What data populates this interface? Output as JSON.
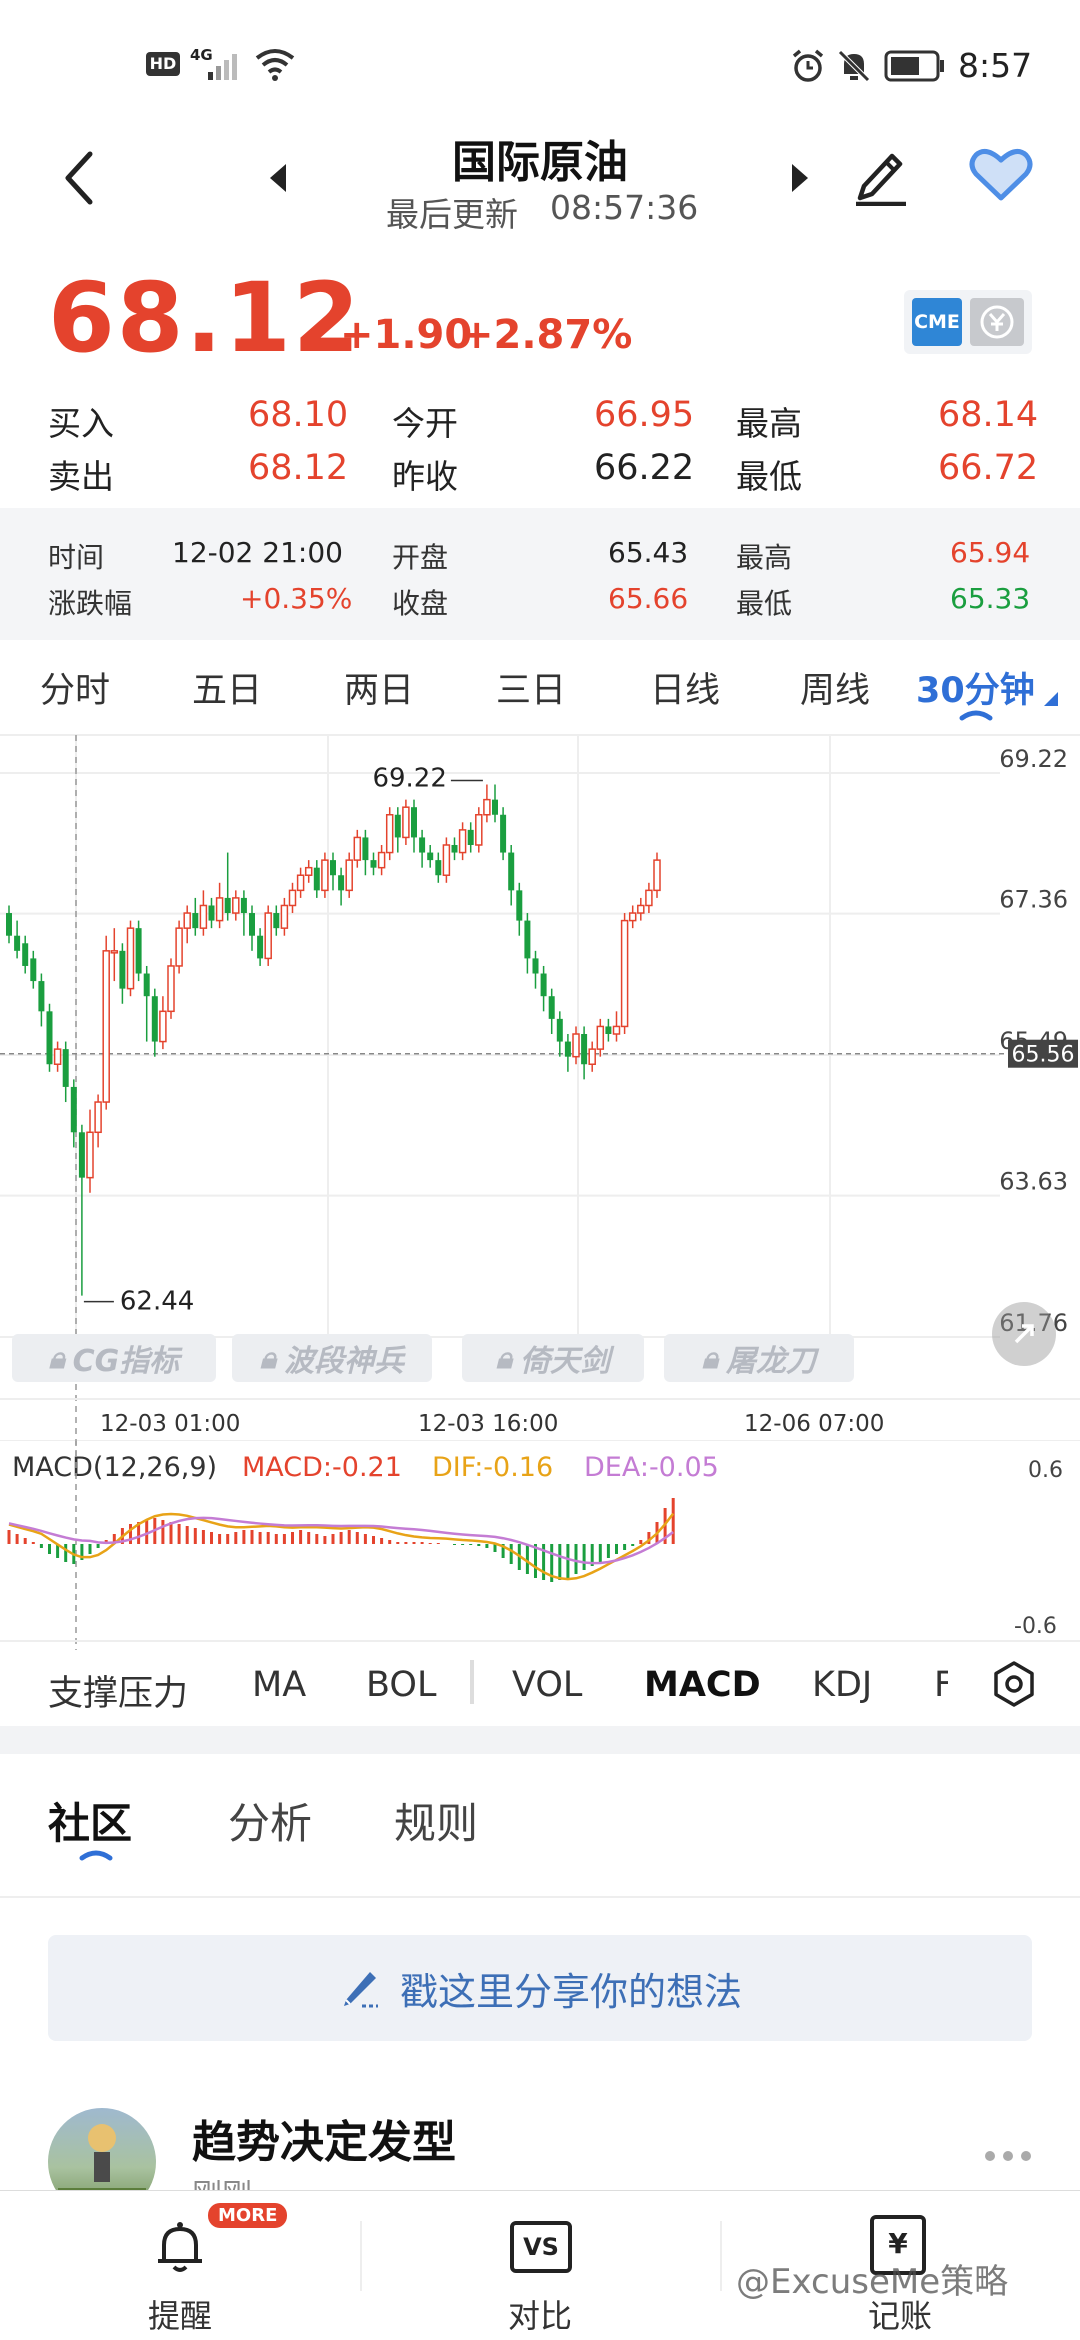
{
  "status_bar": {
    "hd_label": "HD",
    "network_label": "4G",
    "time": "8:57"
  },
  "header": {
    "title": "国际原油",
    "last_update_label": "最后更新",
    "last_update_time": "08:57:36"
  },
  "quote": {
    "price": "68.12",
    "change": "+1.90",
    "change_pct": "+2.87%",
    "exchange_badge": "CME",
    "buy_label": "买入",
    "buy": "68.10",
    "sell_label": "卖出",
    "sell": "68.12",
    "open_label": "今开",
    "open": "66.95",
    "prev_close_label": "昨收",
    "prev_close": "66.22",
    "high_label": "最高",
    "high": "68.14",
    "low_label": "最低",
    "low": "66.72"
  },
  "candle_detail": {
    "time_label": "时间",
    "time": "12-02 21:00",
    "chg_label": "涨跌幅",
    "chg": "+0.35%",
    "open_label": "开盘",
    "open": "65.43",
    "close_label": "收盘",
    "close": "65.66",
    "high_label": "最高",
    "high": "65.94",
    "low_label": "最低",
    "low": "65.33"
  },
  "period_tabs": [
    {
      "label": "分时"
    },
    {
      "label": "五日"
    },
    {
      "label": "两日"
    },
    {
      "label": "三日"
    },
    {
      "label": "日线"
    },
    {
      "label": "周线"
    },
    {
      "label": "30分钟",
      "active": true
    }
  ],
  "chart_data": {
    "type": "candlestick",
    "y_ticks": [
      "69.22",
      "67.36",
      "65.49",
      "63.63",
      "61.76"
    ],
    "ylim": [
      61.76,
      69.22
    ],
    "x_labels": [
      "12-03 01:00",
      "12-03 16:00",
      "12-06 07:00"
    ],
    "max_label": "69.22",
    "min_label": "62.44",
    "current_price_label": "65.56",
    "candles": [
      [
        67.5,
        67.2,
        67.6,
        67.1
      ],
      [
        67.2,
        67.0,
        67.4,
        66.9
      ],
      [
        67.1,
        66.8,
        67.2,
        66.7
      ],
      [
        66.9,
        66.6,
        67.0,
        66.5
      ],
      [
        66.6,
        66.2,
        66.7,
        66.0
      ],
      [
        66.2,
        65.5,
        66.3,
        65.4
      ],
      [
        65.5,
        65.7,
        65.8,
        65.4
      ],
      [
        65.7,
        65.2,
        65.8,
        65.0
      ],
      [
        65.2,
        64.6,
        65.3,
        64.4
      ],
      [
        64.6,
        64.0,
        64.7,
        62.44
      ],
      [
        64.0,
        64.6,
        64.9,
        63.8
      ],
      [
        64.6,
        65.0,
        65.1,
        64.4
      ],
      [
        65.0,
        67.0,
        67.2,
        64.9
      ],
      [
        67.0,
        67.0,
        67.3,
        66.6
      ],
      [
        67.0,
        66.5,
        67.1,
        66.3
      ],
      [
        66.5,
        67.3,
        67.4,
        66.4
      ],
      [
        67.3,
        66.7,
        67.4,
        66.6
      ],
      [
        66.7,
        66.4,
        66.8,
        65.8
      ],
      [
        66.4,
        65.8,
        66.5,
        65.6
      ],
      [
        65.8,
        66.2,
        66.4,
        65.7
      ],
      [
        66.2,
        66.8,
        66.9,
        66.1
      ],
      [
        66.8,
        67.3,
        67.4,
        66.7
      ],
      [
        67.3,
        67.5,
        67.6,
        67.1
      ],
      [
        67.5,
        67.3,
        67.7,
        67.2
      ],
      [
        67.3,
        67.6,
        67.8,
        67.2
      ],
      [
        67.6,
        67.4,
        67.7,
        67.3
      ],
      [
        67.4,
        67.7,
        67.9,
        67.3
      ],
      [
        67.7,
        67.5,
        68.3,
        67.4
      ],
      [
        67.5,
        67.7,
        67.8,
        67.4
      ],
      [
        67.7,
        67.5,
        67.8,
        67.2
      ],
      [
        67.5,
        67.2,
        67.6,
        67.0
      ],
      [
        67.2,
        66.9,
        67.3,
        66.8
      ],
      [
        66.9,
        67.5,
        67.6,
        66.8
      ],
      [
        67.5,
        67.3,
        67.6,
        67.2
      ],
      [
        67.3,
        67.6,
        67.7,
        67.2
      ],
      [
        67.6,
        67.8,
        67.9,
        67.5
      ],
      [
        67.8,
        68.0,
        68.1,
        67.7
      ],
      [
        68.0,
        68.1,
        68.2,
        67.9
      ],
      [
        68.1,
        67.8,
        68.2,
        67.7
      ],
      [
        67.8,
        68.2,
        68.3,
        67.7
      ],
      [
        68.2,
        68.0,
        68.3,
        67.8
      ],
      [
        68.0,
        67.8,
        68.1,
        67.6
      ],
      [
        67.8,
        68.2,
        68.3,
        67.7
      ],
      [
        68.2,
        68.5,
        68.6,
        68.1
      ],
      [
        68.5,
        68.2,
        68.6,
        68.0
      ],
      [
        68.2,
        68.1,
        68.3,
        68.0
      ],
      [
        68.1,
        68.3,
        68.4,
        68.0
      ],
      [
        68.3,
        68.8,
        68.9,
        68.2
      ],
      [
        68.8,
        68.5,
        68.9,
        68.3
      ],
      [
        68.5,
        68.9,
        69.0,
        68.4
      ],
      [
        68.9,
        68.5,
        69.0,
        68.3
      ],
      [
        68.5,
        68.3,
        68.6,
        68.1
      ],
      [
        68.3,
        68.2,
        68.4,
        68.1
      ],
      [
        68.2,
        68.0,
        68.3,
        67.9
      ],
      [
        68.0,
        68.4,
        68.5,
        67.9
      ],
      [
        68.4,
        68.3,
        68.5,
        68.2
      ],
      [
        68.3,
        68.6,
        68.7,
        68.2
      ],
      [
        68.6,
        68.4,
        68.7,
        68.3
      ],
      [
        68.4,
        68.8,
        68.9,
        68.3
      ],
      [
        68.8,
        69.0,
        69.2,
        68.7
      ],
      [
        69.0,
        68.8,
        69.2,
        68.7
      ],
      [
        68.8,
        68.3,
        68.9,
        68.2
      ],
      [
        68.3,
        67.8,
        68.4,
        67.6
      ],
      [
        67.8,
        67.4,
        67.9,
        67.2
      ],
      [
        67.4,
        66.9,
        67.5,
        66.7
      ],
      [
        66.9,
        66.7,
        67.0,
        66.5
      ],
      [
        66.7,
        66.4,
        66.8,
        66.2
      ],
      [
        66.4,
        66.1,
        66.5,
        65.9
      ],
      [
        66.1,
        65.8,
        66.2,
        65.6
      ],
      [
        65.8,
        65.6,
        65.9,
        65.4
      ],
      [
        65.6,
        65.9,
        66.0,
        65.5
      ],
      [
        65.9,
        65.5,
        66.0,
        65.3
      ],
      [
        65.5,
        65.7,
        65.8,
        65.4
      ],
      [
        65.7,
        66.0,
        66.1,
        65.6
      ],
      [
        66.0,
        65.9,
        66.1,
        65.8
      ],
      [
        65.9,
        66.0,
        66.2,
        65.8
      ],
      [
        66.0,
        67.4,
        67.5,
        65.9
      ],
      [
        67.4,
        67.5,
        67.6,
        67.3
      ],
      [
        67.5,
        67.6,
        67.7,
        67.4
      ],
      [
        67.6,
        67.8,
        67.9,
        67.5
      ],
      [
        67.8,
        68.2,
        68.3,
        67.7
      ]
    ]
  },
  "locked_indicators": [
    {
      "label": "CG指标"
    },
    {
      "label": "波段神兵"
    },
    {
      "label": "倚天剑"
    },
    {
      "label": "屠龙刀"
    }
  ],
  "macd": {
    "title": "MACD(12,26,9)",
    "macd": "MACD:-0.21",
    "dif": "DIF:-0.16",
    "dea": "DEA:-0.05",
    "y_top": "0.6",
    "y_bottom": "-0.6",
    "colors": {
      "macd": "#e4432d",
      "dif": "#e8a317",
      "dea": "#c47cd4"
    }
  },
  "indicator_tabs": [
    {
      "label": "支撑压力"
    },
    {
      "label": "MA"
    },
    {
      "label": "BOL"
    },
    {
      "label": "VOL"
    },
    {
      "label": "MACD",
      "active": true
    },
    {
      "label": "KDJ"
    },
    {
      "label": "F"
    }
  ],
  "community": {
    "tabs": [
      {
        "label": "社区",
        "active": true
      },
      {
        "label": "分析"
      },
      {
        "label": "规则"
      }
    ],
    "share_placeholder": "戳这里分享你的想法",
    "post_title": "趋势决定发型",
    "post_time": "刚刚"
  },
  "bottom_nav": {
    "alert_label": "提醒",
    "more_badge": "MORE",
    "compare_label": "对比",
    "compare_icon_text": "VS",
    "ledger_label": "记账",
    "ledger_icon_text": "¥"
  },
  "watermark": "@ExcuseMe策略",
  "colors": {
    "up": "#e4432d",
    "down": "#1a9e3f",
    "accent": "#2f6fd6"
  }
}
